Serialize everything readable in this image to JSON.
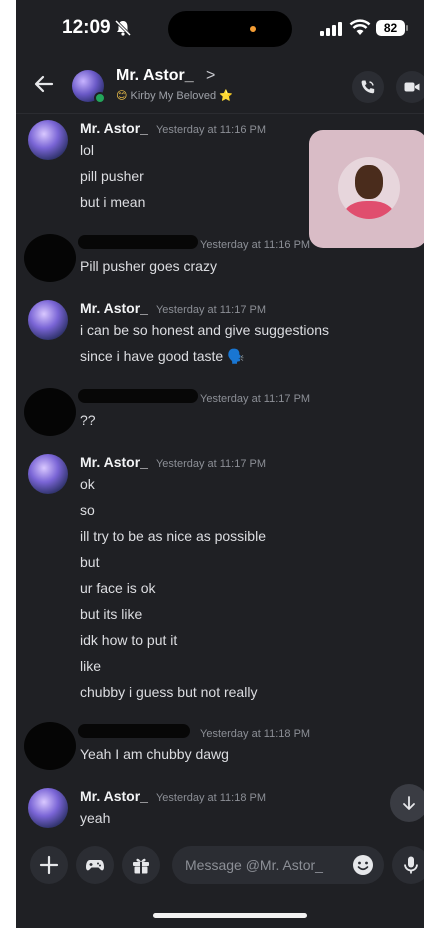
{
  "status_bar": {
    "time": "12:09",
    "battery": "82"
  },
  "header": {
    "name": "Mr. Astor_",
    "chevron": ">",
    "status_text": "Kirby My Beloved",
    "status_emoji_left": "😊",
    "status_emoji_right": "⭐"
  },
  "messages": [
    {
      "author": "Mr. Astor_",
      "timestamp": "Yesterday at 11:16 PM",
      "lines": [
        "lol",
        "pill pusher",
        "but i mean"
      ]
    },
    {
      "author": "",
      "timestamp": "Yesterday at 11:16 PM",
      "lines": [
        "Pill pusher goes crazy"
      ]
    },
    {
      "author": "Mr. Astor_",
      "timestamp": "Yesterday at 11:17 PM",
      "lines": [
        "i can be so honest and give suggestions",
        "since i have good taste 🗣️"
      ]
    },
    {
      "author": "",
      "timestamp": "Yesterday at 11:17 PM",
      "lines": [
        "??"
      ]
    },
    {
      "author": "Mr. Astor_",
      "timestamp": "Yesterday at 11:17 PM",
      "lines": [
        "ok",
        "so",
        "ill try to be as nice as possible",
        "but",
        "ur face is ok",
        "but its like",
        "idk how to put it",
        "like",
        "chubby i guess but not really"
      ]
    },
    {
      "author": "",
      "timestamp": "Yesterday at 11:18 PM",
      "lines": [
        "Yeah I am chubby dawg"
      ]
    },
    {
      "author": "Mr. Astor_",
      "timestamp": "Yesterday at 11:18 PM",
      "lines": [
        "yeah"
      ]
    }
  ],
  "composer": {
    "placeholder": "Message @Mr. Astor_"
  },
  "colors": {
    "background": "#1f2024",
    "surface": "#2b2d33",
    "online": "#23a55a"
  },
  "icons": [
    "back-arrow-icon",
    "phone-call-icon",
    "video-icon",
    "plus-icon",
    "gamepad-icon",
    "gift-icon",
    "emoji-icon",
    "microphone-icon",
    "arrow-down-icon",
    "bell-muted-icon"
  ]
}
